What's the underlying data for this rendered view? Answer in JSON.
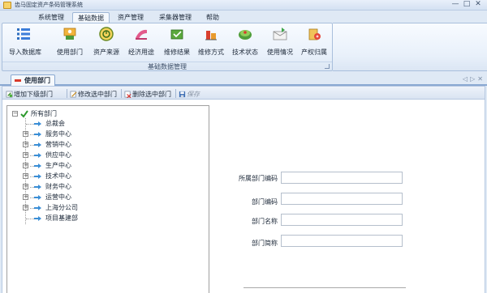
{
  "window": {
    "title": "齿马固定资产条码管理系统",
    "controls": [
      "—",
      "□",
      "✕"
    ]
  },
  "menu": {
    "tabs": [
      {
        "label": "系统管理",
        "active": false
      },
      {
        "label": "基础数据",
        "active": true
      },
      {
        "label": "资产管理",
        "active": false
      },
      {
        "label": "采集器管理",
        "active": false
      },
      {
        "label": "帮助",
        "active": false
      }
    ]
  },
  "ribbon": {
    "group_label": "基础数据管理",
    "buttons": [
      {
        "label": "导入数据库",
        "icon": "import-database-icon"
      },
      {
        "label": "使用部门",
        "icon": "department-icon"
      },
      {
        "label": "资产来源",
        "icon": "asset-source-icon"
      },
      {
        "label": "经济用途",
        "icon": "economic-use-icon"
      },
      {
        "label": "维修结果",
        "icon": "repair-result-icon"
      },
      {
        "label": "维修方式",
        "icon": "repair-method-icon"
      },
      {
        "label": "技术状态",
        "icon": "tech-status-icon"
      },
      {
        "label": "使用情况",
        "icon": "usage-icon"
      },
      {
        "label": "产权归属",
        "icon": "ownership-icon"
      }
    ]
  },
  "document": {
    "tab_label": "使用部门",
    "nav": [
      "◁",
      "▷",
      "✕"
    ]
  },
  "toolbar": {
    "add": "增加下级部门",
    "edit": "修改选中部门",
    "delete": "删除选中部门",
    "save": "保存"
  },
  "tree": {
    "root": "所有部门",
    "items": [
      {
        "label": "总裁会",
        "expandable": false
      },
      {
        "label": "服务中心",
        "expandable": true
      },
      {
        "label": "营销中心",
        "expandable": true
      },
      {
        "label": "供应中心",
        "expandable": true
      },
      {
        "label": "生产中心",
        "expandable": true
      },
      {
        "label": "技术中心",
        "expandable": true
      },
      {
        "label": "财务中心",
        "expandable": true
      },
      {
        "label": "运营中心",
        "expandable": true
      },
      {
        "label": "上海分公司",
        "expandable": true
      },
      {
        "label": "项目基建部",
        "expandable": false
      }
    ]
  },
  "form": {
    "fields": [
      {
        "label": "所属部门编码",
        "value": ""
      },
      {
        "label": "部门编码",
        "value": ""
      },
      {
        "label": "部门名称",
        "value": ""
      },
      {
        "label": "部门简称",
        "value": ""
      }
    ]
  },
  "colors": {
    "accent": "#3c7dd9",
    "ribbon_bg": "#e8f0fa",
    "tree_arrow": "#3a8ed6"
  }
}
